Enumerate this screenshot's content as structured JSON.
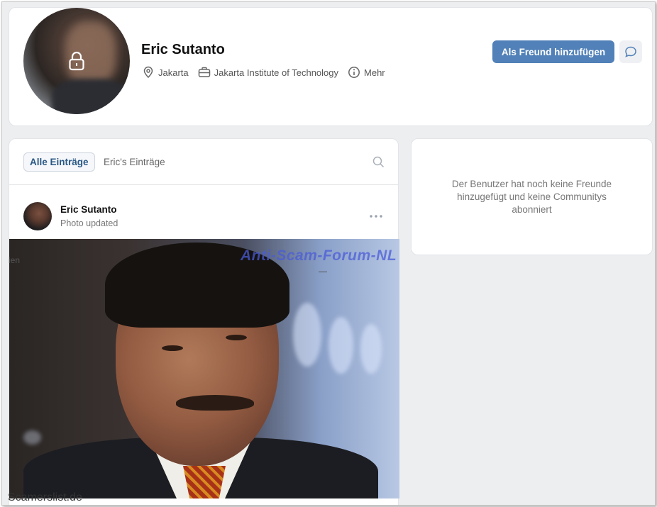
{
  "profile": {
    "name": "Eric Sutanto",
    "location": "Jakarta",
    "work": "Jakarta Institute of Technology",
    "more_label": "Mehr",
    "add_friend_label": "Als Freund hinzufügen"
  },
  "feed": {
    "tabs": [
      {
        "label": "Alle Einträge",
        "active": true
      },
      {
        "label": "Eric's Einträge",
        "active": false
      }
    ],
    "post": {
      "author": "Eric Sutanto",
      "subtitle": "Photo updated"
    }
  },
  "friends": {
    "empty_text": "Der Benutzer hat noch keine Freunde hinzugefügt und keine Communitys abonniert"
  },
  "overlays": {
    "watermark": "Anti-Scam-Forum-NL",
    "side_label": "ien",
    "bottom_watermark": "Scamerslist.de"
  },
  "colors": {
    "accent": "#5181b8",
    "watermark": "#4a5bd8"
  },
  "icons": [
    "lock-icon",
    "location-pin-icon",
    "briefcase-icon",
    "info-icon",
    "chat-icon",
    "search-icon",
    "more-dots-icon"
  ]
}
